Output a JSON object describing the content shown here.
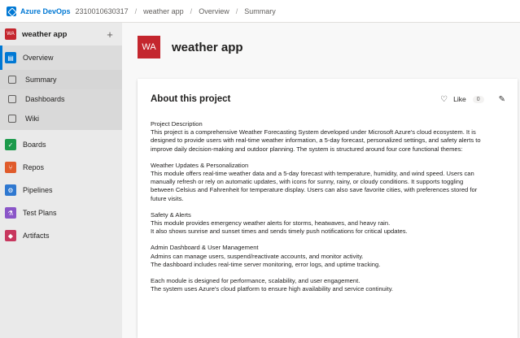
{
  "topbar": {
    "brand": "Azure DevOps",
    "org": "2310010630317",
    "project": "weather app",
    "section": "Overview",
    "page": "Summary"
  },
  "sidebar": {
    "project_initials": "WA",
    "project_name": "weather app",
    "add_label": "+",
    "items": [
      {
        "label": "Overview",
        "icon": "overview-icon"
      },
      {
        "label": "Summary",
        "icon": "summary-icon"
      },
      {
        "label": "Dashboards",
        "icon": "dashboards-icon"
      },
      {
        "label": "Wiki",
        "icon": "wiki-icon"
      },
      {
        "label": "Boards",
        "icon": "boards-icon"
      },
      {
        "label": "Repos",
        "icon": "repos-icon"
      },
      {
        "label": "Pipelines",
        "icon": "pipelines-icon"
      },
      {
        "label": "Test Plans",
        "icon": "test-plans-icon"
      },
      {
        "label": "Artifacts",
        "icon": "artifacts-icon"
      }
    ]
  },
  "main": {
    "initials": "WA",
    "title": "weather app"
  },
  "about": {
    "title": "About this project",
    "like_label": "Like",
    "like_count": "0",
    "lines": [
      "Project Description",
      "This project is a comprehensive Weather Forecasting System developed under Microsoft Azure's cloud ecosystem. It is",
      "designed to provide users with real-time weather information, a 5-day forecast, personalized settings, and safety alerts to",
      "improve daily decision-making and outdoor planning. The system is structured around four core functional themes:",
      "",
      "Weather Updates & Personalization",
      "This module offers real-time weather data and a 5-day forecast with temperature, humidity, and wind speed. Users can",
      "manually refresh or rely on automatic updates, with icons for sunny, rainy, or cloudy conditions. It supports toggling",
      "between Celsius and Fahrenheit for temperature display. Users can also save favorite cities, with preferences stored for",
      "future visits.",
      "",
      "Safety & Alerts",
      "This module provides emergency weather alerts for storms, heatwaves, and heavy rain.",
      "It also shows sunrise and sunset times and sends timely push notifications for critical updates.",
      "",
      "Admin Dashboard & User Management",
      "Admins can manage users, suspend/reactivate accounts, and monitor activity.",
      "The dashboard includes real-time server monitoring, error logs, and uptime tracking.",
      "",
      "Each module is designed for performance, scalability, and user engagement.",
      "The system uses Azure's cloud platform to ensure high availability and service continuity."
    ]
  }
}
